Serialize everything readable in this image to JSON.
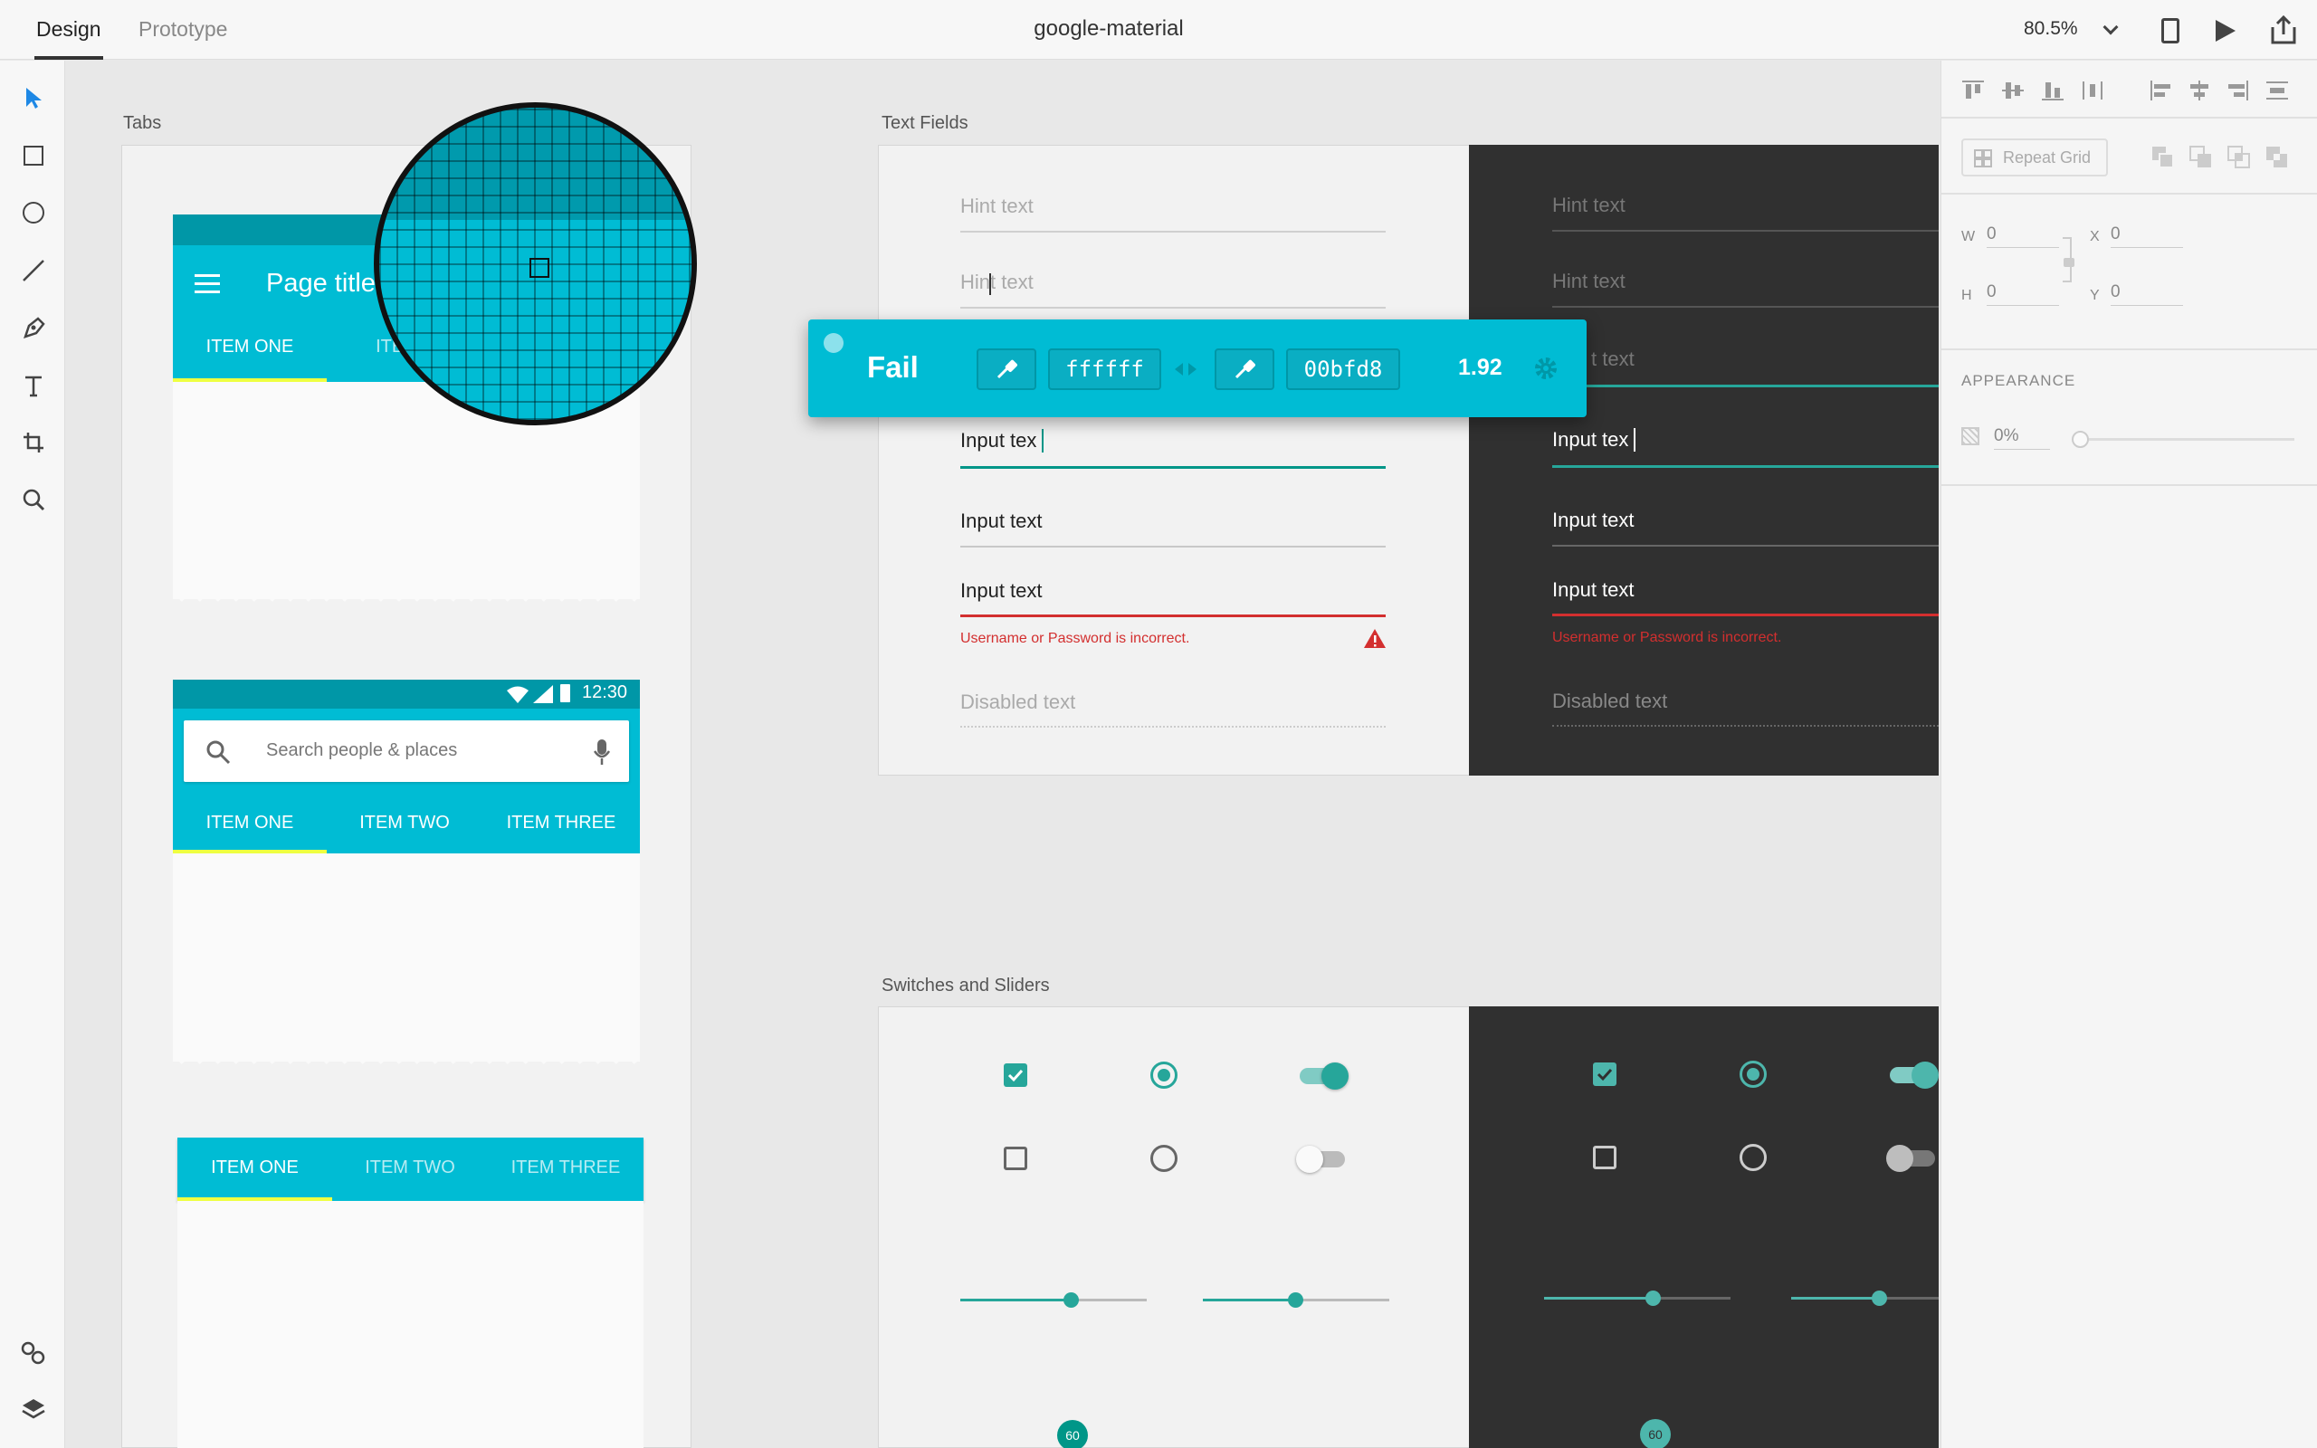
{
  "topbar": {
    "tabs": [
      "Design",
      "Prototype"
    ],
    "title": "google-material",
    "zoom": "80.5%"
  },
  "toolbar": {
    "tools": [
      "select-tool",
      "rectangle-tool",
      "ellipse-tool",
      "line-tool",
      "pen-tool",
      "text-tool",
      "artboard-tool",
      "zoom-tool"
    ],
    "bottom": [
      "symbols-icon",
      "layers-icon"
    ]
  },
  "canvas": {
    "tabs_label": "Tabs",
    "textfields_label": "Text Fields",
    "switches_label": "Switches and Sliders",
    "appbar": {
      "title": "Page title",
      "tabs": [
        "ITEM ONE",
        "ITEM"
      ],
      "status_time": "12:30",
      "search_placeholder": "Search people & places",
      "tabs2": [
        "ITEM ONE",
        "ITEM TWO",
        "ITEM THREE"
      ],
      "tabs3": [
        "ITEM ONE",
        "ITEM TWO",
        "ITEM THREE"
      ]
    },
    "fields_light": {
      "hint1": "Hint text",
      "hint2": "Hint text",
      "input_active": "Input tex",
      "input1": "Input text",
      "input_error": "Input text",
      "error_msg": "Username or Password is incorrect.",
      "disabled": "Disabled text"
    },
    "fields_dark": {
      "hint1": "Hint text",
      "hint2": "Hint text",
      "hint3": "t text",
      "input_active": "Input tex",
      "input1": "Input text",
      "input_error": "Input text",
      "error_msg": "Username or Password is incorrect.",
      "disabled": "Disabled text"
    },
    "slider_value_light": "60",
    "slider_value_dark": "60"
  },
  "contrast_popup": {
    "status": "Fail",
    "fg_hex": "ffffff",
    "bg_hex": "00bfd8",
    "ratio": "1.92"
  },
  "rightpanel": {
    "repeat_grid": "Repeat Grid",
    "w_label": "W",
    "w_value": "0",
    "h_label": "H",
    "h_value": "0",
    "x_label": "X",
    "x_value": "0",
    "y_label": "Y",
    "y_value": "0",
    "appearance_label": "APPEARANCE",
    "opacity": "0%"
  },
  "colors": {
    "cyan": "#00bcd4",
    "teal_dark": "#0097a7",
    "accent": "#009688",
    "error": "#d32f2f",
    "dark_board": "#303030"
  }
}
